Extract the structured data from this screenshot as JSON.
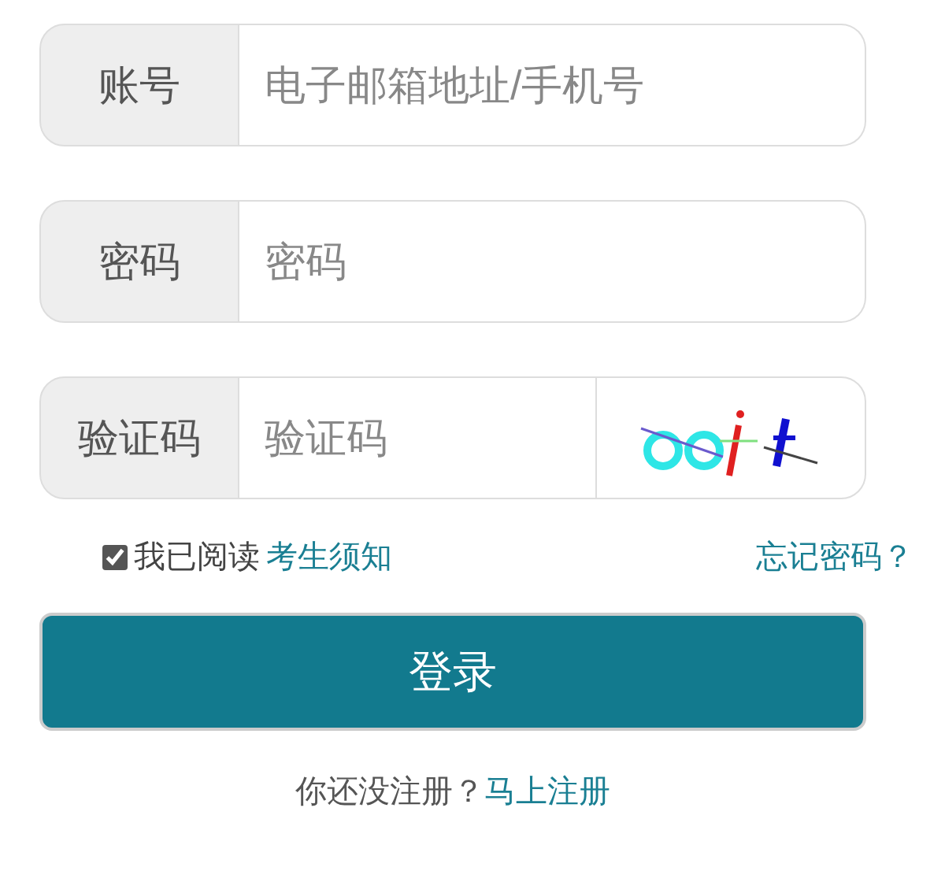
{
  "fields": [
    {
      "kind": "text",
      "label": "账号",
      "placeholder": "电子邮箱地址/手机号"
    },
    {
      "kind": "password",
      "label": "密码",
      "placeholder": "密码"
    },
    {
      "kind": "captcha",
      "label": "验证码",
      "placeholder": "验证码"
    }
  ],
  "agreement": {
    "checked": true,
    "text": "我已阅读",
    "link": "考生须知"
  },
  "forgot_link": "忘记密码？",
  "login_button": "登录",
  "register": {
    "text": "你还没注册？",
    "link": "马上注册"
  }
}
